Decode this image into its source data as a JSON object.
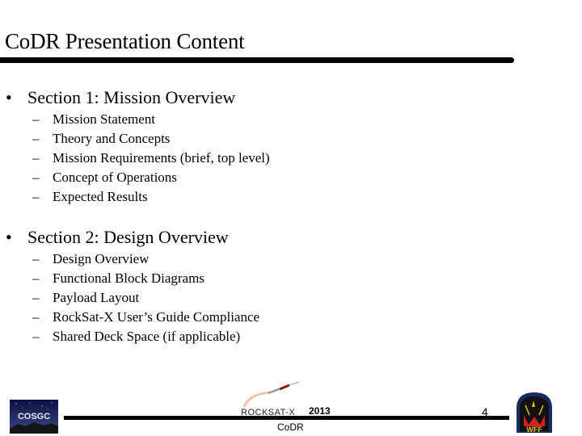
{
  "slide": {
    "title": "CoDR Presentation Content",
    "sections": [
      {
        "bullet": "•",
        "title": "Section 1: Mission Overview",
        "items": [
          {
            "dash": "–",
            "label": "Mission Statement"
          },
          {
            "dash": "–",
            "label": "Theory and Concepts"
          },
          {
            "dash": "–",
            "label": "Mission Requirements (brief, top level)"
          },
          {
            "dash": "–",
            "label": "Concept of Operations"
          },
          {
            "dash": "–",
            "label": "Expected Results"
          }
        ]
      },
      {
        "bullet": "•",
        "title": "Section 2: Design Overview",
        "items": [
          {
            "dash": "–",
            "label": "Design Overview"
          },
          {
            "dash": "–",
            "label": "Functional Block Diagrams"
          },
          {
            "dash": "–",
            "label": "Payload Layout"
          },
          {
            "dash": "–",
            "label": "RockSat-X User’s Guide Compliance"
          },
          {
            "dash": "–",
            "label": "Shared Deck Space (if applicable)"
          }
        ]
      }
    ]
  },
  "footer": {
    "left_logo_text": "COSGC",
    "center_logo_text": "ROCKSAT-X",
    "year": "2013",
    "label": "CoDR",
    "page_number": "4",
    "right_logo_text": "WFF"
  },
  "colors": {
    "text": "#000000",
    "background": "#ffffff",
    "cosgc_sky": "#1c1f5a",
    "wff_red": "#d42020",
    "wff_gold": "#e8c000",
    "rocket_red": "#8b1a1a"
  }
}
